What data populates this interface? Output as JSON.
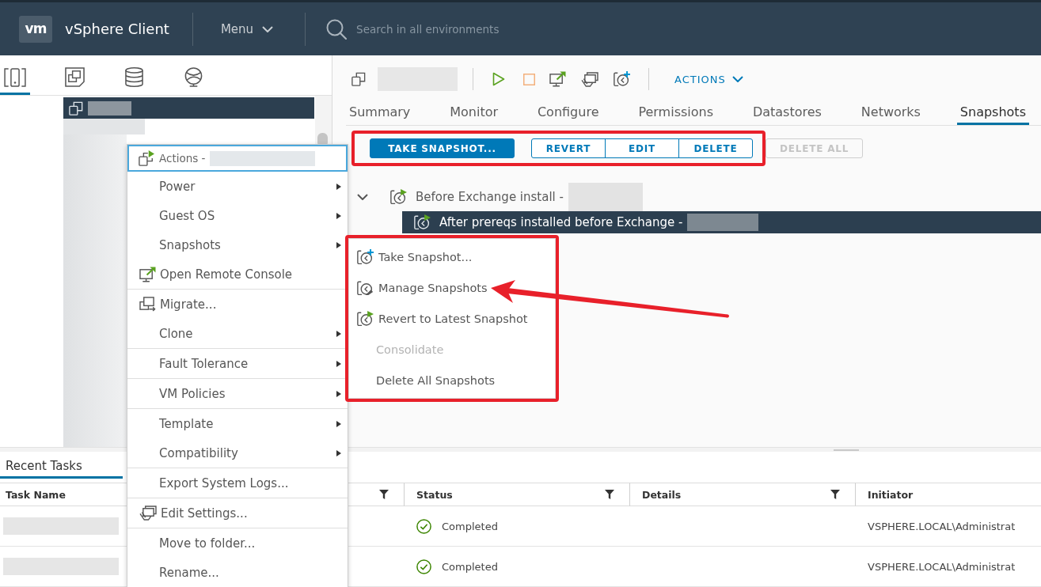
{
  "header": {
    "logo": "vm",
    "title": "vSphere Client",
    "menu_label": "Menu",
    "search": {
      "placeholder": "Search in all environments"
    }
  },
  "navigator": {
    "tabs": [
      {
        "selected": true
      },
      {
        "selected": false
      },
      {
        "selected": false
      },
      {
        "selected": false
      }
    ],
    "tree": {
      "redacted": true,
      "rows": [
        {
          "selected": true,
          "redacted": true
        }
      ]
    }
  },
  "object_header": {
    "name_redacted": true,
    "actions_label": "ACTIONS"
  },
  "tabs": [
    {
      "label": "Summary",
      "selected": false
    },
    {
      "label": "Monitor",
      "selected": false
    },
    {
      "label": "Configure",
      "selected": false
    },
    {
      "label": "Permissions",
      "selected": false
    },
    {
      "label": "Datastores",
      "selected": false
    },
    {
      "label": "Networks",
      "selected": false
    },
    {
      "label": "Snapshots",
      "selected": true
    }
  ],
  "snapshot_toolbar": {
    "buttons": [
      {
        "label": "TAKE SNAPSHOT...",
        "kind": "primary",
        "disabled": false,
        "highlighted": true
      },
      {
        "label": "REVERT",
        "kind": "segment",
        "disabled": false,
        "highlighted": true
      },
      {
        "label": "EDIT",
        "kind": "segment",
        "disabled": false,
        "highlighted": true
      },
      {
        "label": "DELETE",
        "kind": "segment",
        "disabled": false,
        "highlighted": true
      },
      {
        "label": "DELETE ALL",
        "kind": "outline",
        "disabled": true,
        "highlighted": false
      }
    ]
  },
  "snapshot_tree": [
    {
      "label": "Before Exchange install -",
      "redacted": true,
      "selected": false,
      "expanded": true,
      "children": [
        {
          "label": "After prereqs installed before Exchange -",
          "redacted": true,
          "selected": true
        }
      ]
    }
  ],
  "context_menu": {
    "title": "Actions -",
    "title_redacted": true,
    "groups": [
      {
        "items": [
          {
            "label": "Power",
            "submenu": true
          },
          {
            "label": "Guest OS",
            "submenu": true
          },
          {
            "label": "Snapshots",
            "submenu": true
          },
          {
            "label": "Open Remote Console",
            "submenu": false
          }
        ]
      },
      {
        "items": [
          {
            "label": "Migrate...",
            "submenu": false
          },
          {
            "label": "Clone",
            "submenu": true
          }
        ]
      },
      {
        "items": [
          {
            "label": "Fault Tolerance",
            "submenu": true
          }
        ]
      },
      {
        "items": [
          {
            "label": "VM Policies",
            "submenu": true
          }
        ]
      },
      {
        "items": [
          {
            "label": "Template",
            "submenu": true
          },
          {
            "label": "Compatibility",
            "submenu": true
          }
        ]
      },
      {
        "items": [
          {
            "label": "Export System Logs...",
            "submenu": false
          }
        ]
      },
      {
        "items": [
          {
            "label": "Edit Settings...",
            "submenu": false
          }
        ]
      },
      {
        "items": [
          {
            "label": "Move to folder...",
            "submenu": false
          },
          {
            "label": "Rename...",
            "submenu": false
          }
        ]
      }
    ]
  },
  "snapshots_submenu": {
    "highlighted": true,
    "items": [
      {
        "label": "Take Snapshot...",
        "disabled": false,
        "pointed_at": false
      },
      {
        "label": "Manage Snapshots",
        "disabled": false,
        "pointed_at": true
      },
      {
        "label": "Revert to Latest Snapshot",
        "disabled": false,
        "pointed_at": false
      },
      {
        "label": "Consolidate",
        "disabled": true,
        "pointed_at": false
      },
      {
        "label": "Delete All Snapshots",
        "disabled": false,
        "pointed_at": false
      }
    ]
  },
  "recent_tasks": {
    "tab": {
      "label": "Recent Tasks",
      "selected": true
    },
    "columns": [
      {
        "label": "Task Name",
        "filterable": false
      },
      {
        "filterable": true
      },
      {
        "label": "Status",
        "filterable": true
      },
      {
        "label": "Details",
        "filterable": true
      },
      {
        "label": "Initiator",
        "filterable": false
      }
    ],
    "rows": [
      {
        "task_redacted": true,
        "status": "Completed",
        "succeeded": true,
        "initiator": "VSPHERE.LOCAL\\Administrat"
      },
      {
        "task_redacted": true,
        "status": "Completed",
        "succeeded": true,
        "initiator": "VSPHERE.LOCAL\\Administrat"
      }
    ]
  }
}
